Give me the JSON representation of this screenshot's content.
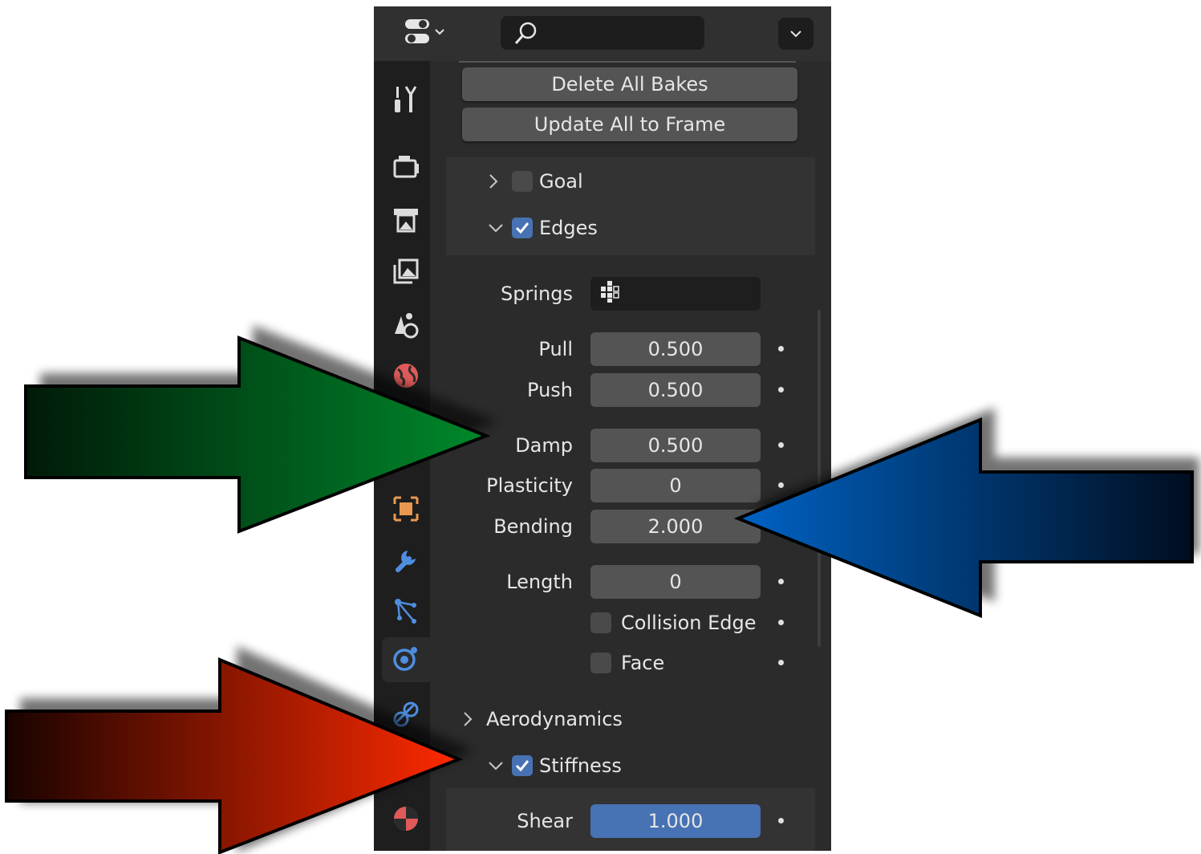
{
  "header": {
    "editor_type_icon": "properties-editor-icon",
    "search_icon": "search-icon",
    "menu_icon": "chevron-down-icon"
  },
  "sidebar": {
    "tabs": [
      {
        "icon": "tool-icon"
      },
      {
        "icon": "render-icon"
      },
      {
        "icon": "output-icon"
      },
      {
        "icon": "view-layer-icon"
      },
      {
        "icon": "scene-icon"
      },
      {
        "icon": "world-icon"
      },
      {
        "icon": "object-icon"
      },
      {
        "icon": "modifier-icon"
      },
      {
        "icon": "particles-icon"
      },
      {
        "icon": "physics-icon",
        "active": true
      },
      {
        "icon": "constraints-icon"
      },
      {
        "icon": "material-icon"
      }
    ]
  },
  "bake": {
    "delete_all": "Delete All Bakes",
    "update_all": "Update All to Frame"
  },
  "goal": {
    "label": "Goal",
    "checked": false,
    "expanded": false
  },
  "edges": {
    "label": "Edges",
    "checked": true,
    "expanded": true,
    "springs_label": "Springs",
    "pull_label": "Pull",
    "pull": "0.500",
    "push_label": "Push",
    "push": "0.500",
    "damp_label": "Damp",
    "damp": "0.500",
    "plasticity_label": "Plasticity",
    "plasticity": "0",
    "bending_label": "Bending",
    "bending": "2.000",
    "length_label": "Length",
    "length": "0",
    "collision_edge_label": "Collision Edge",
    "face_label": "Face"
  },
  "aerodynamics": {
    "label": "Aerodynamics",
    "expanded": false
  },
  "stiffness": {
    "label": "Stiffness",
    "checked": true,
    "expanded": true,
    "shear_label": "Shear",
    "shear": "1.000"
  },
  "annotations": {
    "green_arrow_color": "#00892b",
    "blue_arrow_color": "#0063c5",
    "red_arrow_color": "#ff2a00"
  }
}
